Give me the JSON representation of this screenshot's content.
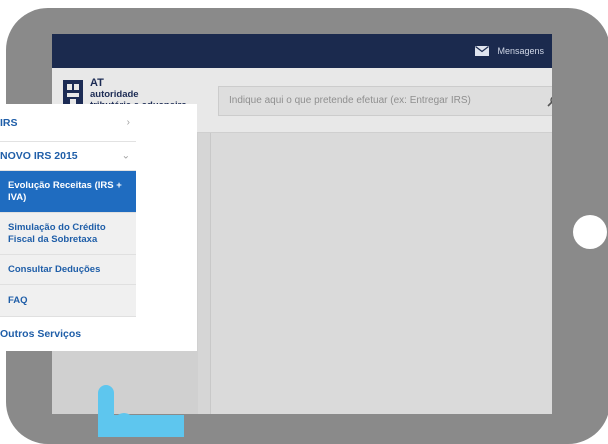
{
  "topbar": {
    "messages_label": "Mensagens"
  },
  "header": {
    "logo": {
      "line1": "AT",
      "line2": "autoridade",
      "line3": "tributária e aduaneira"
    },
    "search": {
      "placeholder": "Indique aqui o que pretende efetuar (ex: Entregar IRS)"
    }
  },
  "sidebar": {
    "items": [
      {
        "label": "IRS",
        "icon": "chevron-right-icon"
      },
      {
        "label": "NOVO IRS 2015",
        "icon": "chevron-down-icon"
      },
      {
        "label": "Outros Serviços"
      }
    ],
    "subitems": [
      {
        "label": "Evolução Receitas (IRS + IVA)",
        "active": true
      },
      {
        "label": "Simulação do Crédito Fiscal da Sobretaxa",
        "active": false
      },
      {
        "label": "Consultar Deduções",
        "active": false
      },
      {
        "label": "FAQ",
        "active": false
      }
    ]
  },
  "colors": {
    "topbar": "#1b2a4e",
    "link_blue": "#1f5ea8",
    "active_blue": "#1f6cc0",
    "hand": "#5ec6ee",
    "tablet": "#8a8a8a"
  }
}
